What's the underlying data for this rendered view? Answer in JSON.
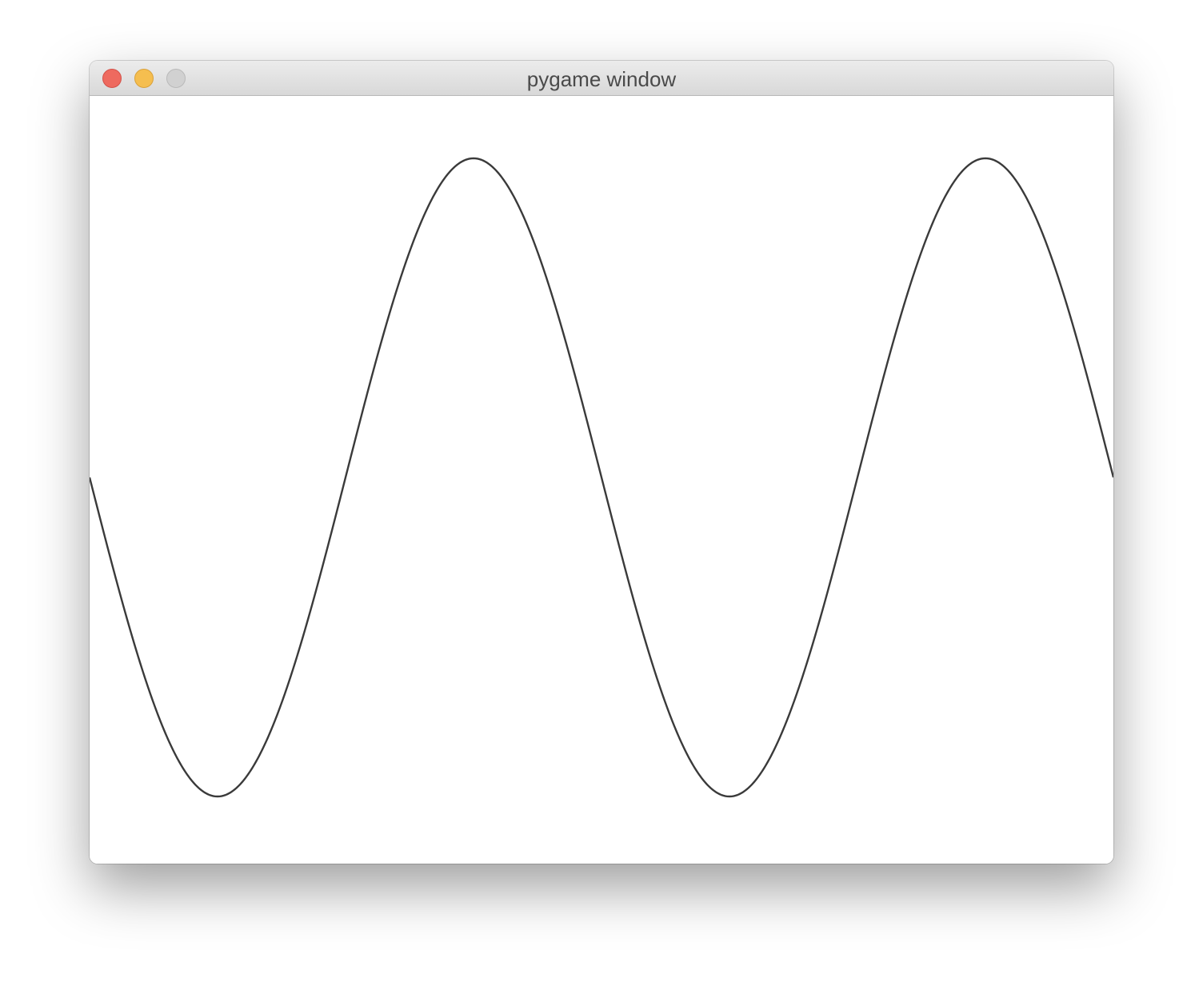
{
  "window": {
    "title": "pygame window",
    "buttons": {
      "close": "close",
      "minimize": "minimize",
      "zoom": "zoom"
    }
  },
  "colors": {
    "close": "#ee6a5f",
    "minimize": "#f5be4f",
    "zoom_disabled": "#d1d1d1",
    "curve": "#3a3a3a",
    "canvas_bg": "#ffffff"
  },
  "chart_data": {
    "type": "line",
    "function": "sine",
    "cycles_visible": 2,
    "grid": false,
    "title": "",
    "xlabel": "",
    "ylabel": ""
  }
}
